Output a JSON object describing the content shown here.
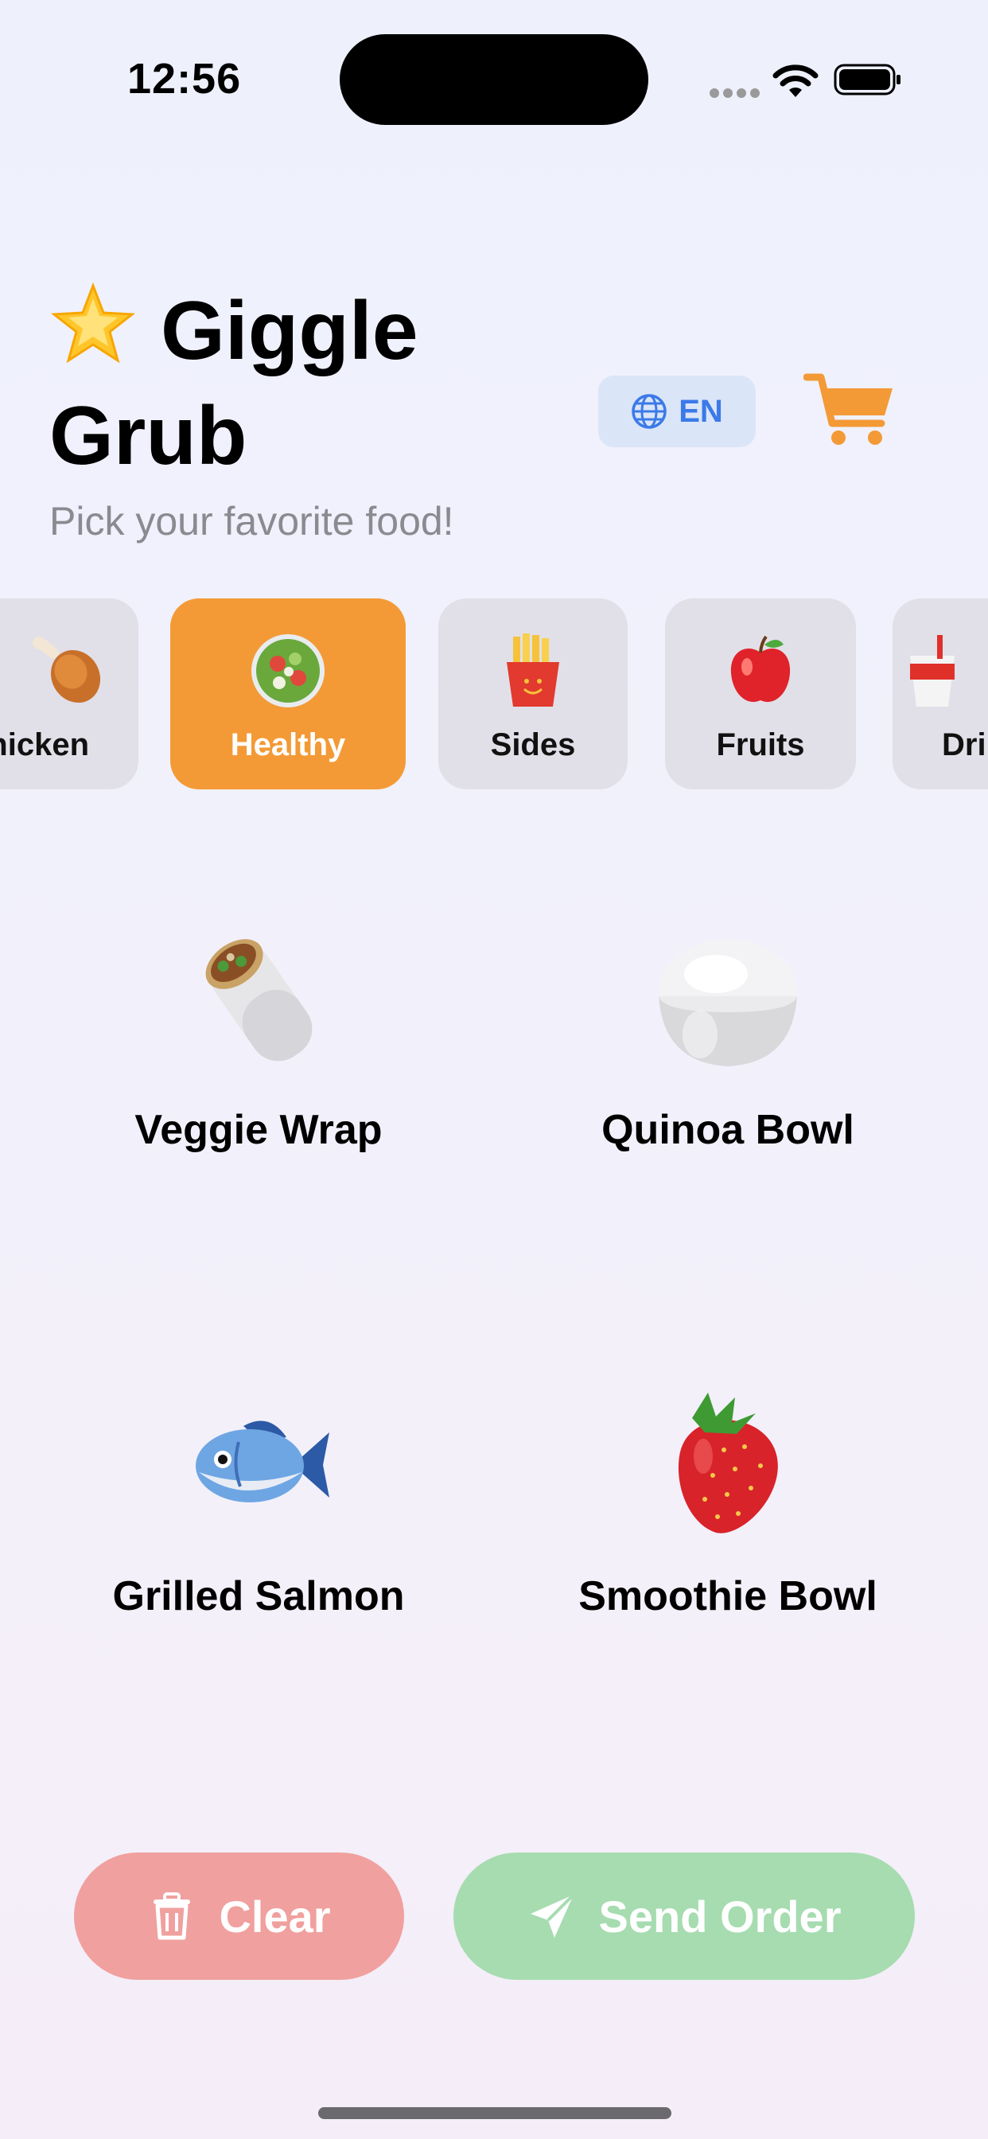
{
  "status_bar": {
    "time": "12:56"
  },
  "header": {
    "title": "Giggle Grub",
    "subtitle": "Pick your favorite food!",
    "language_label": "EN"
  },
  "categories": [
    {
      "label": "Chicken",
      "icon": "drumstick-icon",
      "active": false
    },
    {
      "label": "Healthy",
      "icon": "salad-icon",
      "active": true
    },
    {
      "label": "Sides",
      "icon": "fries-icon",
      "active": false
    },
    {
      "label": "Fruits",
      "icon": "apple-icon",
      "active": false
    },
    {
      "label": "Drinks",
      "icon": "drink-icon",
      "active": false
    }
  ],
  "menu": [
    {
      "label": "Veggie Wrap",
      "icon": "burrito-icon"
    },
    {
      "label": "Quinoa Bowl",
      "icon": "rice-bowl-icon"
    },
    {
      "label": "Grilled Salmon",
      "icon": "fish-icon"
    },
    {
      "label": "Smoothie Bowl",
      "icon": "strawberry-icon"
    }
  ],
  "actions": {
    "clear_label": "Clear",
    "send_label": "Send Order"
  },
  "colors": {
    "accent": "#f39a36",
    "clear": "#f0a09e",
    "send": "#a6dcb0",
    "language": "#3b7ae8"
  }
}
